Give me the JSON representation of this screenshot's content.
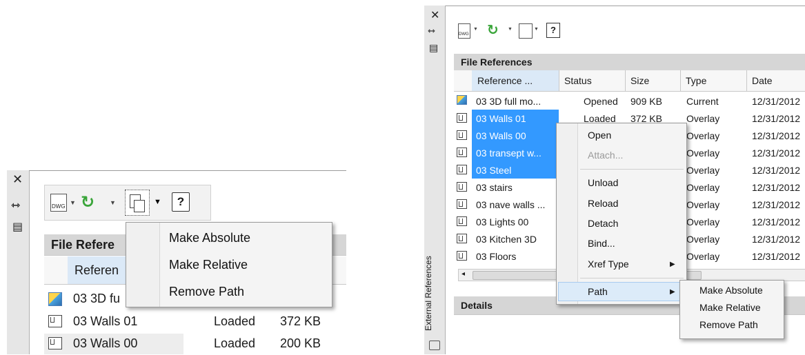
{
  "left_panel": {
    "strip_icons": [
      "close-icon",
      "pin-icon",
      "properties-icon"
    ],
    "close_glyph": "✕",
    "pin_glyph": "⇿",
    "props_glyph": "▤",
    "help_glyph": "?",
    "section_title": "File Refere",
    "column_header": "Referen",
    "path_menu": [
      "Make Absolute",
      "Make Relative",
      "Remove Path"
    ],
    "rows": [
      {
        "name": "03 3D fu",
        "status": "",
        "size": ""
      },
      {
        "name": "03 Walls 01",
        "status": "Loaded",
        "size": "372 KB"
      },
      {
        "name": "03 Walls 00",
        "status": "Loaded",
        "size": "200 KB"
      }
    ]
  },
  "right_panel": {
    "vertical_title": "External References",
    "section_title": "File References",
    "details_title": "Details",
    "columns": [
      "Reference ...",
      "Status",
      "Size",
      "Type",
      "Date"
    ],
    "rows": [
      {
        "name": "03 3D full mo...",
        "status": "Opened",
        "size": "909 KB",
        "type": "Current",
        "date": "12/31/2012"
      },
      {
        "name": "03 Walls 01",
        "status": "Loaded",
        "size": "372 KB",
        "type": "Overlay",
        "date": "12/31/2012"
      },
      {
        "name": "03 Walls 00",
        "status": "",
        "size": "",
        "type": "Overlay",
        "date": "12/31/2012"
      },
      {
        "name": "03 transept w...",
        "status": "",
        "size": "",
        "type": "Overlay",
        "date": "12/31/2012"
      },
      {
        "name": "03 Steel",
        "status": "",
        "size": "",
        "type": "Overlay",
        "date": "12/31/2012"
      },
      {
        "name": "03 stairs",
        "status": "",
        "size": "",
        "type": "Overlay",
        "date": "12/31/2012"
      },
      {
        "name": "03 nave walls ...",
        "status": "",
        "size": "",
        "type": "Overlay",
        "date": "12/31/2012"
      },
      {
        "name": "03 Lights 00",
        "status": "",
        "size": "",
        "type": "Overlay",
        "date": "12/31/2012"
      },
      {
        "name": "03 Kitchen 3D",
        "status": "",
        "size": "",
        "type": "Overlay",
        "date": "12/31/2012"
      },
      {
        "name": "03 Floors",
        "status": "",
        "size": "",
        "type": "Overlay",
        "date": "12/31/2012"
      }
    ],
    "context_menu": {
      "open": "Open",
      "attach": "Attach...",
      "unload": "Unload",
      "reload": "Reload",
      "detach": "Detach",
      "bind": "Bind...",
      "xref_type": "Xref Type",
      "path": "Path"
    },
    "path_submenu": [
      "Make Absolute",
      "Make Relative",
      "Remove Path"
    ]
  },
  "colors": {
    "selection": "#3399ff",
    "header_bg": "#e9e9e9",
    "refresh_green": "#3aa53a"
  }
}
